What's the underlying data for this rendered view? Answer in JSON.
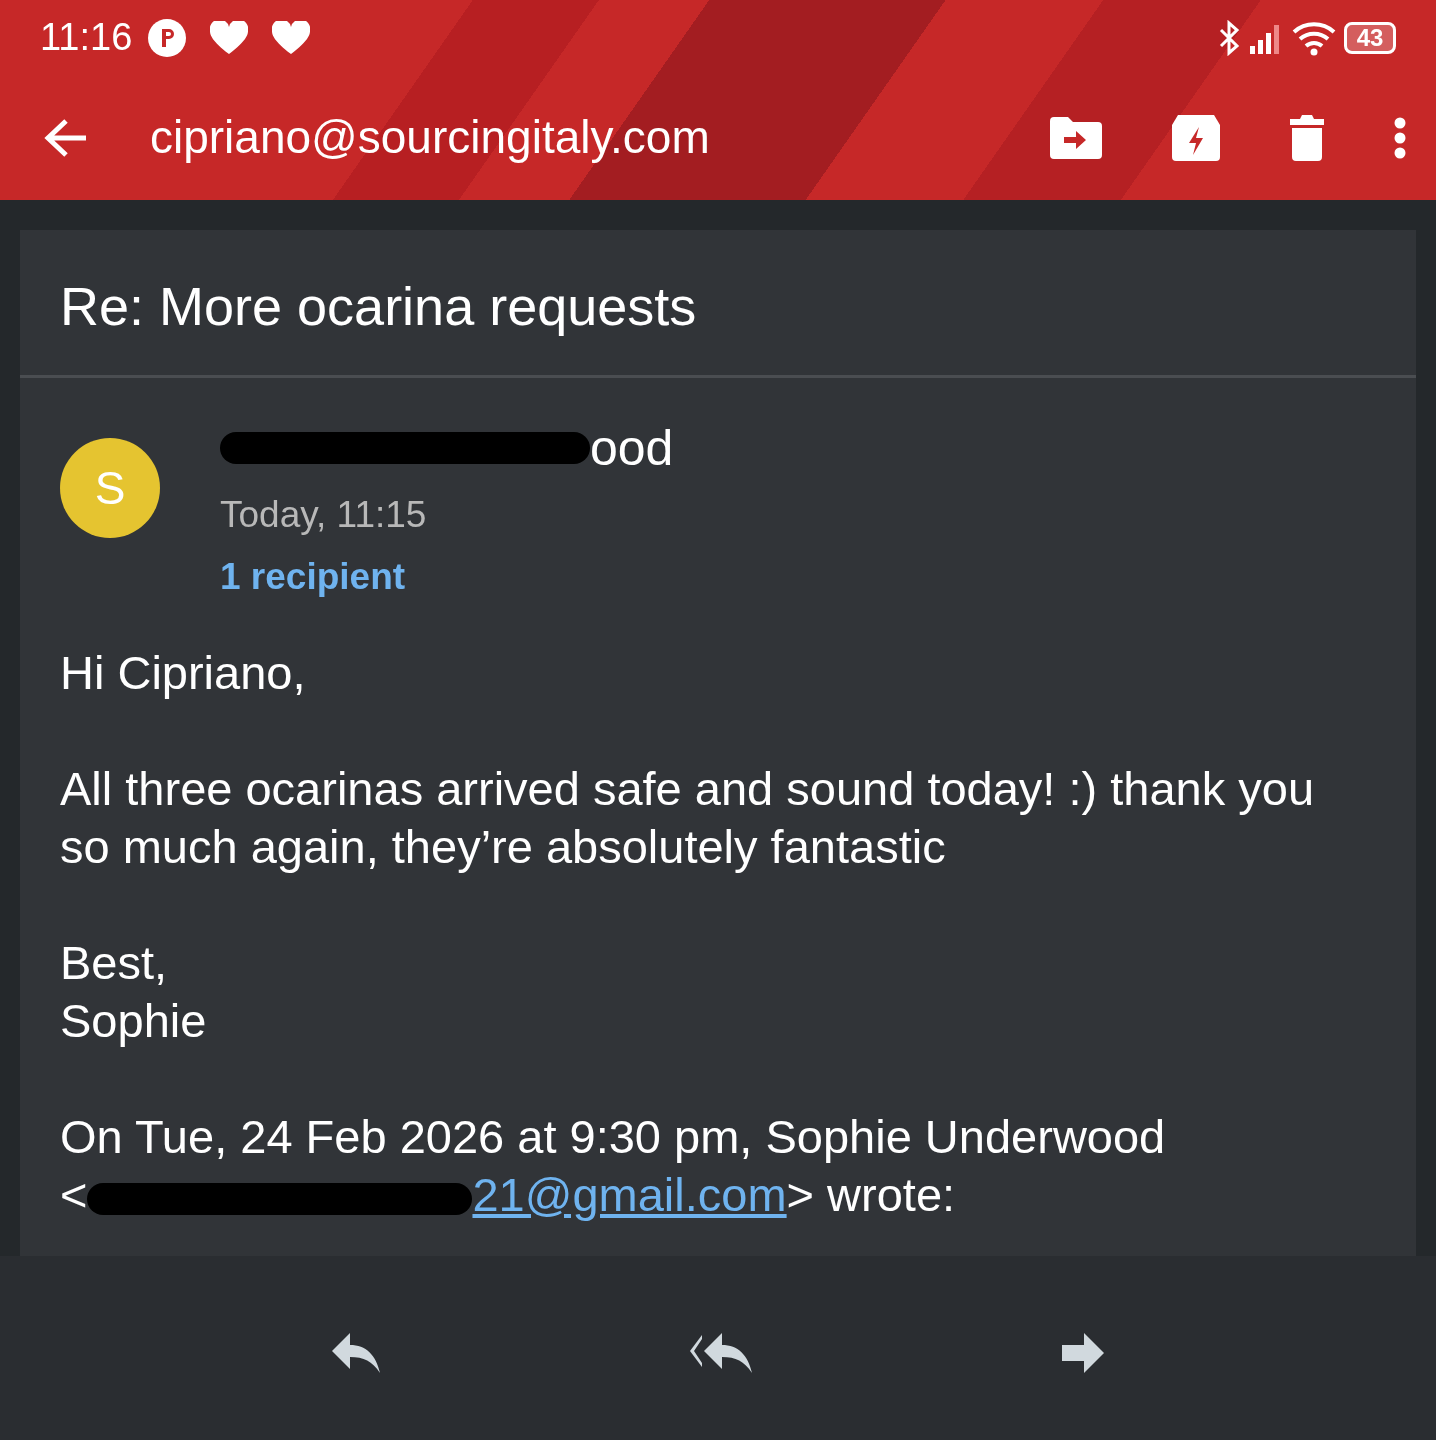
{
  "status_bar": {
    "time": "11:16",
    "battery": "43"
  },
  "toolbar": {
    "title": "cipriano@sourcingitaly.com"
  },
  "message": {
    "subject": "Re: More ocarina requests",
    "sender": {
      "avatar_letter": "S",
      "name": "ood",
      "redacted": true
    },
    "date": "Today, 11:15",
    "recipients": "1 recipient",
    "body": [
      "Hi Cipriano,",
      "All three ocarinas arrived safe and sound today! :) thank you so much again, they’re absolutely fantastic",
      "Best,\nSophie"
    ],
    "quote": {
      "line": "On Tue, 24 Feb 2026 at 9:30 pm, Sophie Underwood",
      "open": "<",
      "email": "21@gmail.com",
      "email_redacted": true,
      "close": "> wrote:"
    }
  }
}
